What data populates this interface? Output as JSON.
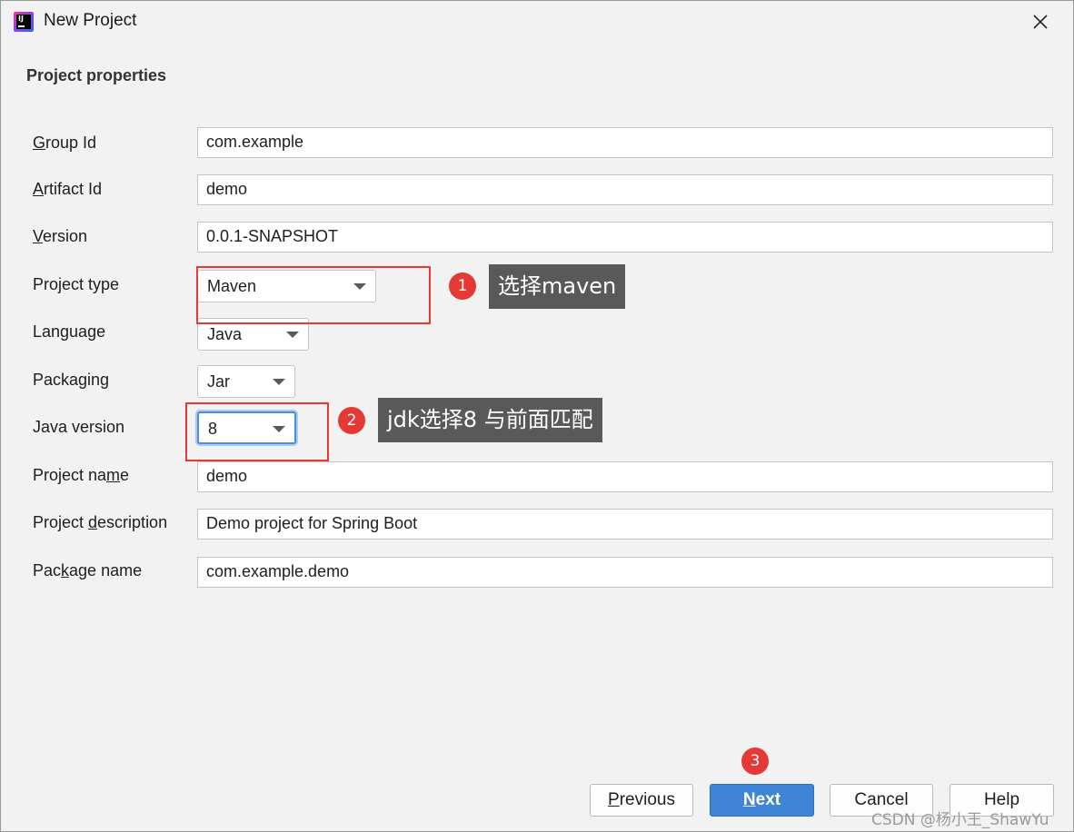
{
  "window": {
    "title": "New Project"
  },
  "section": {
    "title": "Project properties"
  },
  "fields": {
    "group_id": {
      "label_pre": "",
      "label_u": "G",
      "label_post": "roup Id",
      "value": "com.example"
    },
    "artifact_id": {
      "label_pre": "",
      "label_u": "A",
      "label_post": "rtifact Id",
      "value": "demo"
    },
    "version": {
      "label_pre": "",
      "label_u": "V",
      "label_post": "ersion",
      "value": "0.0.1-SNAPSHOT"
    },
    "project_type": {
      "label": "Project type",
      "value": "Maven"
    },
    "language": {
      "label": "Language",
      "value": "Java"
    },
    "packaging": {
      "label": "Packaging",
      "value": "Jar"
    },
    "java_version": {
      "label": "Java version",
      "value": "8"
    },
    "project_name": {
      "label_pre": "Project na",
      "label_u": "m",
      "label_post": "e",
      "value": "demo"
    },
    "project_description": {
      "label_pre": "Project ",
      "label_u": "d",
      "label_post": "escription",
      "value": "Demo project for Spring Boot"
    },
    "package_name": {
      "label_pre": "Pac",
      "label_u": "k",
      "label_post": "age name",
      "value": "com.example.demo"
    }
  },
  "annotations": {
    "step1": {
      "number": "1",
      "text": "选择maven"
    },
    "step2": {
      "number": "2",
      "text": "jdk选择8 与前面匹配"
    },
    "step3": {
      "number": "3"
    },
    "highlight_color": "#e53935"
  },
  "buttons": {
    "previous": {
      "u": "P",
      "rest": "revious"
    },
    "next": {
      "u": "N",
      "rest": "ext"
    },
    "cancel": "Cancel",
    "help": "Help"
  },
  "watermark": "CSDN @杨小王_ShawYu",
  "colors": {
    "primary_button": "#3f85d5",
    "focus_ring": "#4d8fd6"
  }
}
